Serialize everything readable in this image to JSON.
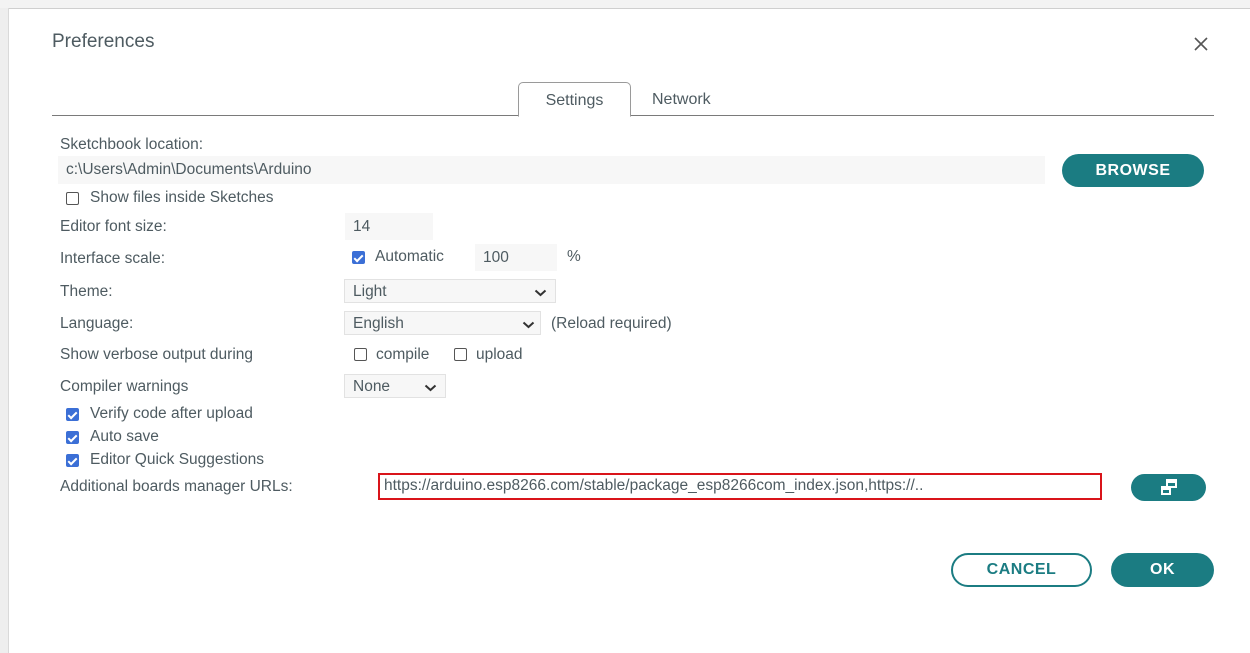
{
  "dialog": {
    "title": "Preferences"
  },
  "tabs": [
    {
      "label": "Settings",
      "active": true
    },
    {
      "label": "Network",
      "active": false
    }
  ],
  "sketchbook": {
    "label": "Sketchbook location:",
    "value": "c:\\Users\\Admin\\Documents\\Arduino",
    "browse_label": "BROWSE",
    "show_files_label": "Show files inside Sketches",
    "show_files_checked": false
  },
  "editor_font": {
    "label": "Editor font size:",
    "value": "14"
  },
  "interface_scale": {
    "label": "Interface scale:",
    "automatic_label": "Automatic",
    "automatic_checked": true,
    "value": "100",
    "unit": "%"
  },
  "theme": {
    "label": "Theme:",
    "value": "Light"
  },
  "language": {
    "label": "Language:",
    "value": "English",
    "note": "(Reload required)"
  },
  "verbose": {
    "label": "Show verbose output during",
    "compile_label": "compile",
    "upload_label": "upload",
    "compile_checked": false,
    "upload_checked": false
  },
  "compiler_warnings": {
    "label": "Compiler warnings",
    "value": "None"
  },
  "options": [
    {
      "label": "Verify code after upload",
      "checked": true
    },
    {
      "label": "Auto save",
      "checked": true
    },
    {
      "label": "Editor Quick Suggestions",
      "checked": true
    }
  ],
  "boards_urls": {
    "label": "Additional boards manager URLs:",
    "value": "https://arduino.esp8266.com/stable/package_esp8266com_index.json,https://.."
  },
  "footer": {
    "cancel_label": "CANCEL",
    "ok_label": "OK"
  },
  "icons": {
    "close": "close-icon",
    "expand": "open-window-icon",
    "dropdown": "chevron-down-icon"
  },
  "colors": {
    "accent": "#1b7c82",
    "checkbox": "#3b6fd6",
    "highlight": "#d9141a"
  }
}
